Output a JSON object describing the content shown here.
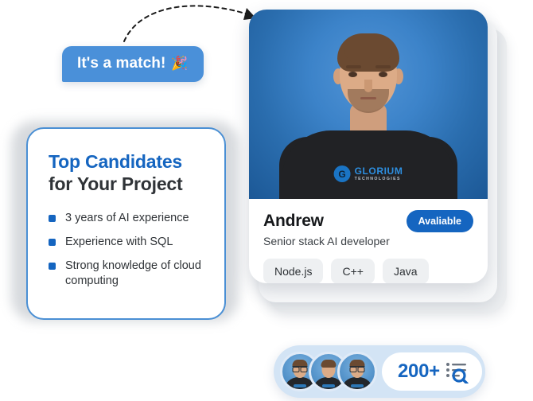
{
  "annotation": {
    "match_bubble": {
      "text": "It's a match!",
      "emoji": "🎉",
      "color": "#4a90d9"
    },
    "connector": {
      "name": "dashed-arrow-connector",
      "style": "dashed-arc-with-arrowhead",
      "color": "#1b1b1b"
    }
  },
  "info_card": {
    "title_line1": "Top Candidates",
    "title_line2": "for Your Project",
    "title_color": "#1565c0",
    "border_color": "#4a8fd4",
    "bullets": [
      "3 years of AI experience",
      "Experience with SQL",
      "Strong knowledge of cloud computing"
    ]
  },
  "candidate_card": {
    "name": "Andrew",
    "role": "Senior stack AI developer",
    "badge": {
      "label": "Avaliable",
      "color": "#1565c0"
    },
    "skills": [
      "Node.js",
      "C++",
      "Java"
    ],
    "photo": {
      "alt": "portrait-of-andrew",
      "shirt_logo_name": "GLORIUM",
      "shirt_logo_sub": "TECHNOLOGIES",
      "shirt_logo_mark": "G",
      "background": "blue-radial-gradient"
    },
    "stack_behind": {
      "cards": 2
    }
  },
  "stat_widget": {
    "count": "200+",
    "avatars": [
      {
        "name": "avatar-candidate-1",
        "glasses": true
      },
      {
        "name": "avatar-candidate-2",
        "glasses": false
      },
      {
        "name": "avatar-candidate-3",
        "glasses": true
      }
    ],
    "icon": "list-search-icon",
    "accent_color": "#1565c0",
    "background": "#d3e4f5"
  }
}
